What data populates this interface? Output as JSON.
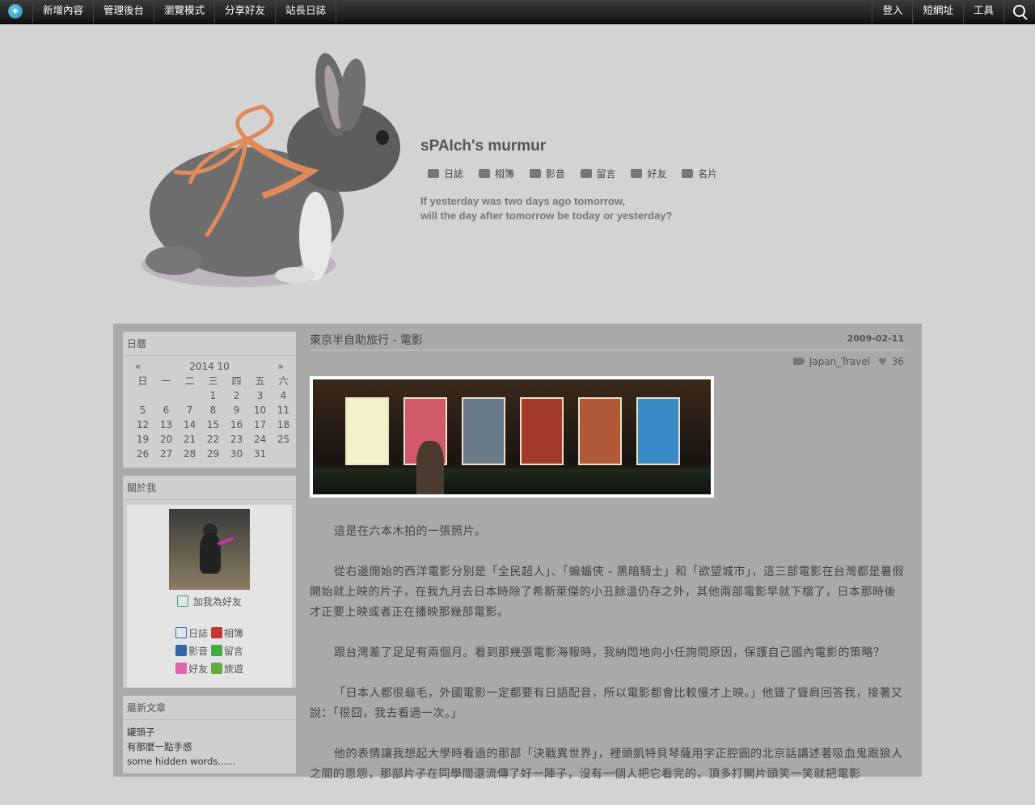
{
  "topbar": {
    "left_items": [
      "新增內容",
      "管理後台",
      "瀏覽模式",
      "分享好友",
      "站長日誌"
    ],
    "right_items": [
      "登入",
      "短網址",
      "工具"
    ]
  },
  "header": {
    "title": "sPAIch's murmur",
    "nav": [
      "日誌",
      "相簿",
      "影音",
      "留言",
      "好友",
      "名片"
    ],
    "tagline_line1": "If yesterday was two days ago tomorrow,",
    "tagline_line2": "will the day after tomorrow be today or yesterday?"
  },
  "sidebar": {
    "calendar": {
      "title": "日曆",
      "prev": "«",
      "month": "2014 10",
      "next": "»",
      "weekdays": [
        "日",
        "一",
        "二",
        "三",
        "四",
        "五",
        "六"
      ],
      "days": [
        "",
        "",
        "",
        "1",
        "2",
        "3",
        "4",
        "5",
        "6",
        "7",
        "8",
        "9",
        "10",
        "11",
        "12",
        "13",
        "14",
        "15",
        "16",
        "17",
        "18",
        "19",
        "20",
        "21",
        "22",
        "23",
        "24",
        "25",
        "26",
        "27",
        "28",
        "29",
        "30",
        "31",
        ""
      ]
    },
    "about": {
      "title": "關於我",
      "add_friend": "加我為好友",
      "links": [
        "日誌",
        "相簿",
        "影音",
        "留言",
        "好友",
        "旅遊"
      ]
    },
    "recent": {
      "title": "最新文章",
      "items": [
        "罐頭子",
        "有那麼一點手感",
        "some hidden words......"
      ]
    }
  },
  "post": {
    "title": "東京半自助旅行 - 電影",
    "date": "2009-02-11",
    "tag": "Japan_Travel",
    "likes": "36",
    "paragraphs": [
      "這是在六本木拍的一張照片。",
      "從右邊開始的西洋電影分別是「全民超人」、「蝙蝠俠 - 黑暗騎士」和「欲望城市」，這三部電影在台灣都是暑假開始就上映的片子，在我九月去日本時除了希斯萊傑的小丑餘溫仍存之外，其他兩部電影早就下檔了，日本那時後才正要上映或者正在播映那幾部電影。",
      "跟台灣差了足足有兩個月。看到那幾張電影海報時，我納悶地向小任詢問原因，保護自己國內電影的策略？",
      "「日本人都很龜毛，外國電影一定都要有日語配音，所以電影都會比較慢才上映。」他聳了聳肩回答我，接著又說：「很囧，我去看過一次。」",
      "他的表情讓我想起大學時看過的那部「決戰異世界」，裡頭凱特貝琴薩用字正腔圓的北京話講述著吸血鬼跟狼人之間的恩怨，那部片子在同學間還流傳了好一陣子，沒有一個人把它看完的，頂多打開片頭笑一笑就把電影"
    ]
  },
  "colors": {
    "page_bg": "#d3d3d3",
    "content_bg": "#a9a9a9",
    "topbar_bg": "#1e1e1e",
    "bow": "#e08a5a"
  }
}
